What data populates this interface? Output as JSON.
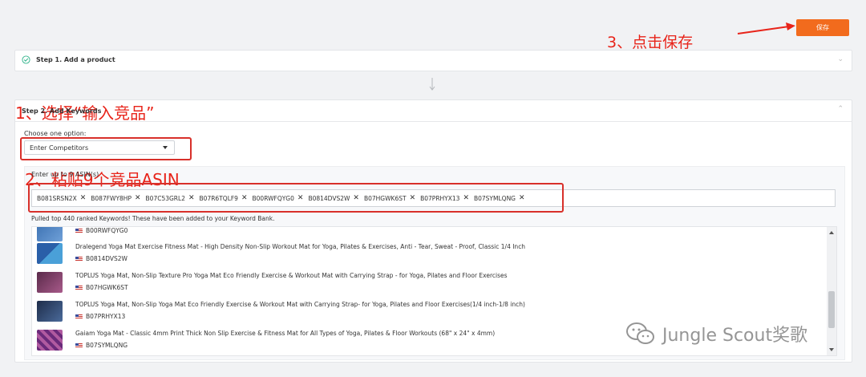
{
  "toolbar": {
    "save_label": "保存"
  },
  "annotations": {
    "step3": "3、点击保存",
    "step1": "1、选择“输入竞品”",
    "step2": "2、粘贴9个竞品ASIN",
    "color": "#e8241a"
  },
  "step1": {
    "title": "Step 1. Add a product"
  },
  "step2": {
    "title": "Step 2. Add Keywords",
    "choose_label": "Choose one option:",
    "selected_option": "Enter Competitors",
    "asin_label": "Enter up to 9 ASIN(s)",
    "asins": [
      "B081SRSN2X",
      "B087FWY8HP",
      "B07C53GRL2",
      "B07R6TQLF9",
      "B00RWFQYG0",
      "B0814DVS2W",
      "B07HGWK6ST",
      "B07PRHYX13",
      "B07SYMLQNG"
    ],
    "status_text": "Pulled top 440 ranked Keywords! These have been added to your Keyword Bank."
  },
  "products": [
    {
      "title": "",
      "asin": "B00RWFQYG0"
    },
    {
      "title": "Dralegend Yoga Mat Exercise Fitness Mat - High Density Non-Slip Workout Mat for Yoga, Pilates & Exercises, Anti - Tear, Sweat - Proof, Classic 1/4 Inch",
      "asin": "B0814DVS2W"
    },
    {
      "title": "TOPLUS Yoga Mat, Non-Slip Texture Pro Yoga Mat Eco Friendly Exercise & Workout Mat with Carrying Strap - for Yoga, Pilates and Floor Exercises",
      "asin": "B07HGWK6ST"
    },
    {
      "title": "TOPLUS Yoga Mat, Non-Slip Yoga Mat Eco Friendly Exercise & Workout Mat with Carrying Strap- for Yoga, Pilates and Floor Exercises(1/4 inch-1/8 inch)",
      "asin": "B07PRHYX13"
    },
    {
      "title": "Gaiam Yoga Mat - Classic 4mm Print Thick Non Slip Exercise & Fitness Mat for All Types of Yoga, Pilates & Floor Workouts (68\" x 24\" x 4mm)",
      "asin": "B07SYMLQNG"
    }
  ],
  "watermark": {
    "text": "Jungle Scout奖歌"
  },
  "colors": {
    "accent": "#f26b1d",
    "annotation": "#e8241a",
    "check": "#2fb38a"
  }
}
